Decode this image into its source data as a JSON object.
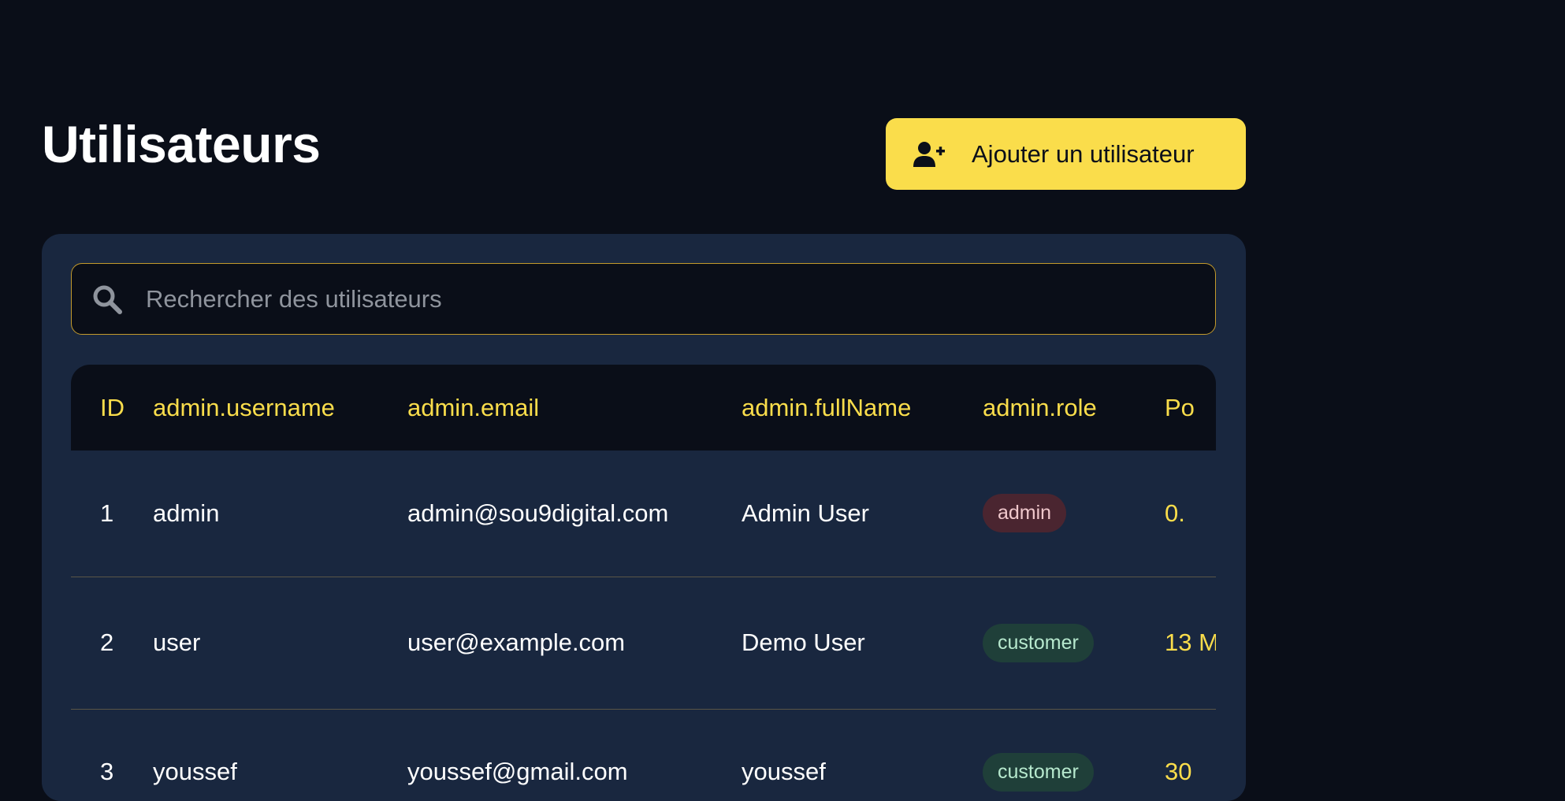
{
  "page": {
    "title": "Utilisateurs",
    "add_button_label": "Ajouter un utilisateur",
    "add_button_icon": "user-plus-icon"
  },
  "search": {
    "placeholder": "Rechercher des utilisateurs",
    "value": "",
    "icon": "search-icon"
  },
  "table": {
    "columns": {
      "id": "ID",
      "username": "admin.username",
      "email": "admin.email",
      "fullname": "admin.fullName",
      "role": "admin.role",
      "points": "Po"
    },
    "rows": [
      {
        "id": "1",
        "username": "admin",
        "email": "admin@sou9digital.com",
        "fullname": "Admin User",
        "role": "admin",
        "points": "0."
      },
      {
        "id": "2",
        "username": "user",
        "email": "user@example.com",
        "fullname": "Demo User",
        "role": "customer",
        "points": "13 M"
      },
      {
        "id": "3",
        "username": "youssef",
        "email": "youssef@gmail.com",
        "fullname": "youssef",
        "role": "customer",
        "points": "30"
      }
    ]
  },
  "colors": {
    "background": "#0a0e18",
    "panel": "#19273f",
    "accent": "#fadd4b",
    "admin_badge": "#4a2530",
    "customer_badge": "#1f3f39"
  }
}
